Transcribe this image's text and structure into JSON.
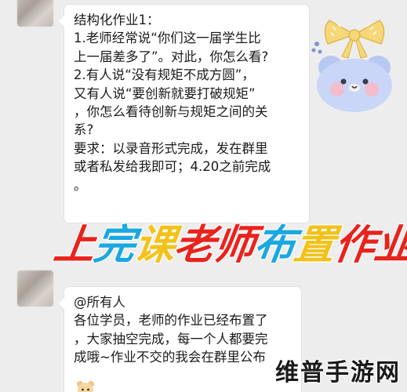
{
  "messages": [
    {
      "lines": [
        "结构化作业1：",
        "1.老师经常说“你们这一届学生比",
        "上一届差多了”。对此，你怎么看?",
        "2.有人说“没有规矩不成方圆”，",
        "又有人说“要创新就要打破规矩”",
        "，你怎么看待创新与规矩之间的关",
        "系?",
        "要求：以录音形式完成，发在群里",
        "或者私发给我即可；4.20之前完成",
        "。"
      ]
    },
    {
      "lines": [
        "@所有人",
        "各位学员，老师的作业已经布置了",
        "，大家抽空完成，每一个人都要完",
        "成哦~作业不交的我会在群里公布"
      ]
    }
  ],
  "overlay_title": {
    "chars": [
      {
        "text": "上",
        "color": "#e8231c"
      },
      {
        "text": "完",
        "color": "#19a8e0"
      },
      {
        "text": "课",
        "color": "#f2c21b"
      },
      {
        "text": "老",
        "color": "#e8231c"
      },
      {
        "text": "师",
        "color": "#e8231c"
      },
      {
        "text": "布",
        "color": "#19a8e0"
      },
      {
        "text": "置",
        "color": "#f2c21b"
      },
      {
        "text": "作",
        "color": "#e8231c"
      },
      {
        "text": "业",
        "color": "#e8231c"
      }
    ]
  },
  "watermark": "维普手游网",
  "colors": {
    "background": "#ededed",
    "bubble": "#ffffff",
    "sticker_bow": "#f6d77a",
    "sticker_face": "#c9d6f7"
  },
  "icons": {
    "sticker": "bear-with-bow-sticker",
    "mini_sticker": "bear-emoji-sticker"
  }
}
